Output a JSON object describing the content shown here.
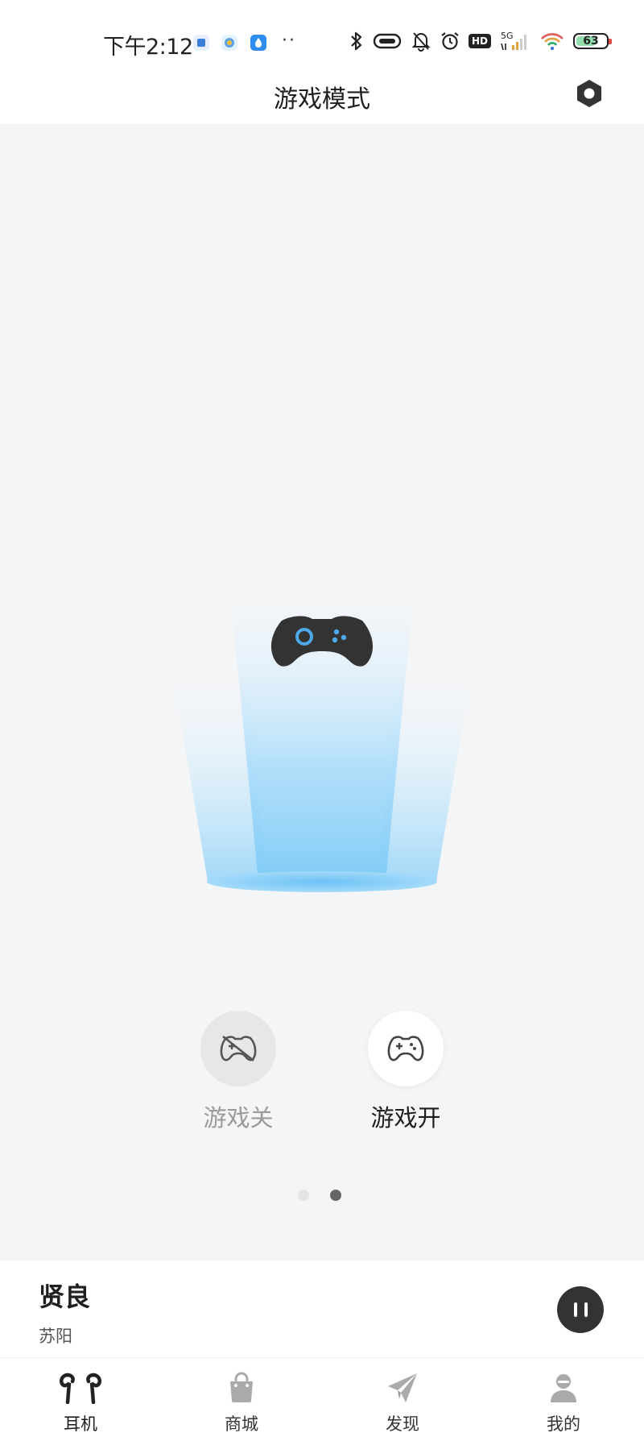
{
  "status_bar": {
    "time": "下午2:12",
    "dots": "··",
    "hd": "HD",
    "signal_label": "5G",
    "battery": "63"
  },
  "header": {
    "title": "游戏模式"
  },
  "game_mode": {
    "off_label": "游戏关",
    "on_label": "游戏开",
    "selected": "on",
    "page_index": 2,
    "page_count": 2
  },
  "now_playing": {
    "title": "贤良",
    "artist": "苏阳",
    "state": "playing"
  },
  "nav": {
    "items": [
      {
        "label": "耳机",
        "icon": "earbuds-icon",
        "active": true
      },
      {
        "label": "商城",
        "icon": "shopping-bag-icon",
        "active": false
      },
      {
        "label": "发现",
        "icon": "paper-plane-icon",
        "active": false
      },
      {
        "label": "我的",
        "icon": "user-icon",
        "active": false
      }
    ]
  },
  "colors": {
    "accent": "#4da9ea",
    "background": "#f4f5f7",
    "controller": "#333333"
  }
}
